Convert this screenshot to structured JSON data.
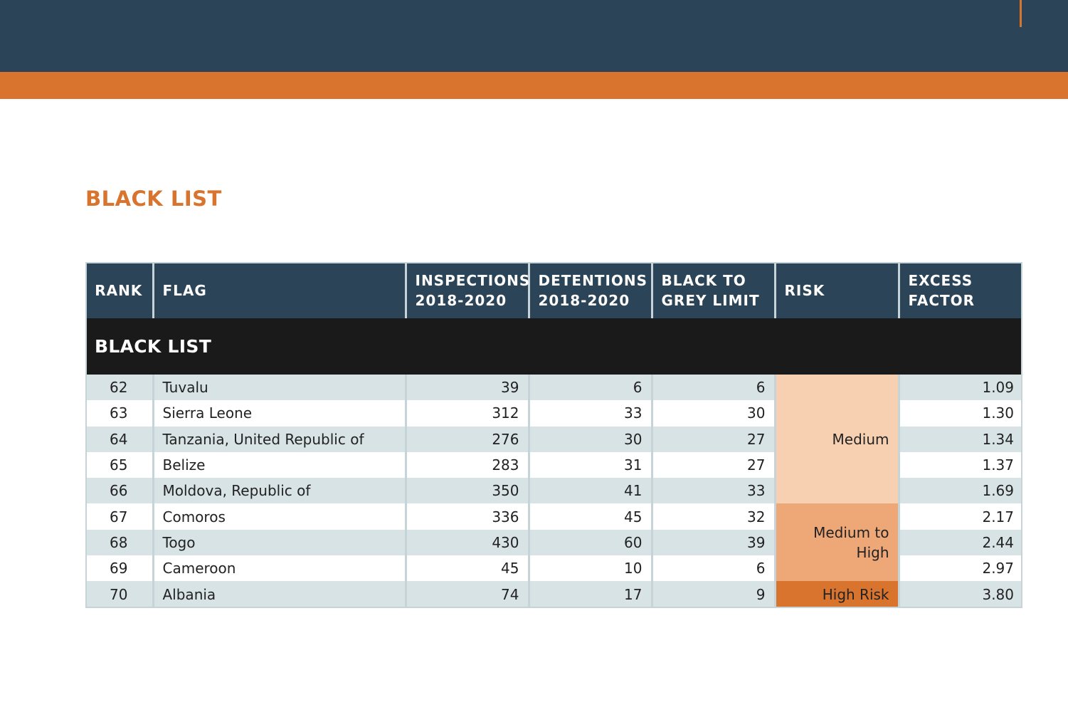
{
  "page": {
    "title": "BLACK LIST"
  },
  "colors": {
    "navy": "#2b4457",
    "orange": "#d9742e",
    "risk_medium": "#f6d0b0",
    "risk_medium_high": "#eea878",
    "risk_high": "#d9742e"
  },
  "table": {
    "headers": {
      "rank": "RANK",
      "flag": "FLAG",
      "inspections": [
        "INSPECTIONS",
        "2018-2020"
      ],
      "detentions": [
        "DETENTIONS",
        "2018-2020"
      ],
      "black_to_grey": [
        "BLACK TO",
        "GREY LIMIT"
      ],
      "risk": "RISK",
      "excess": [
        "EXCESS",
        "FACTOR"
      ]
    },
    "group_label": "BLACK LIST",
    "rows": [
      {
        "rank": "62",
        "flag": "Tuvalu",
        "inspections": "39",
        "detentions": "6",
        "limit": "6",
        "excess": "1.09"
      },
      {
        "rank": "63",
        "flag": "Sierra Leone",
        "inspections": "312",
        "detentions": "33",
        "limit": "30",
        "excess": "1.30"
      },
      {
        "rank": "64",
        "flag": "Tanzania, United Republic of",
        "inspections": "276",
        "detentions": "30",
        "limit": "27",
        "excess": "1.34"
      },
      {
        "rank": "65",
        "flag": "Belize",
        "inspections": "283",
        "detentions": "31",
        "limit": "27",
        "excess": "1.37"
      },
      {
        "rank": "66",
        "flag": "Moldova, Republic of",
        "inspections": "350",
        "detentions": "41",
        "limit": "33",
        "excess": "1.69"
      },
      {
        "rank": "67",
        "flag": "Comoros",
        "inspections": "336",
        "detentions": "45",
        "limit": "32",
        "excess": "2.17"
      },
      {
        "rank": "68",
        "flag": "Togo",
        "inspections": "430",
        "detentions": "60",
        "limit": "39",
        "excess": "2.44"
      },
      {
        "rank": "69",
        "flag": "Cameroon",
        "inspections": "45",
        "detentions": "10",
        "limit": "6",
        "excess": "2.97"
      },
      {
        "rank": "70",
        "flag": "Albania",
        "inspections": "74",
        "detentions": "17",
        "limit": "9",
        "excess": "3.80"
      }
    ],
    "risk_groups": {
      "medium": "Medium",
      "medium_high": [
        "Medium to",
        "High"
      ],
      "high": "High Risk"
    }
  }
}
